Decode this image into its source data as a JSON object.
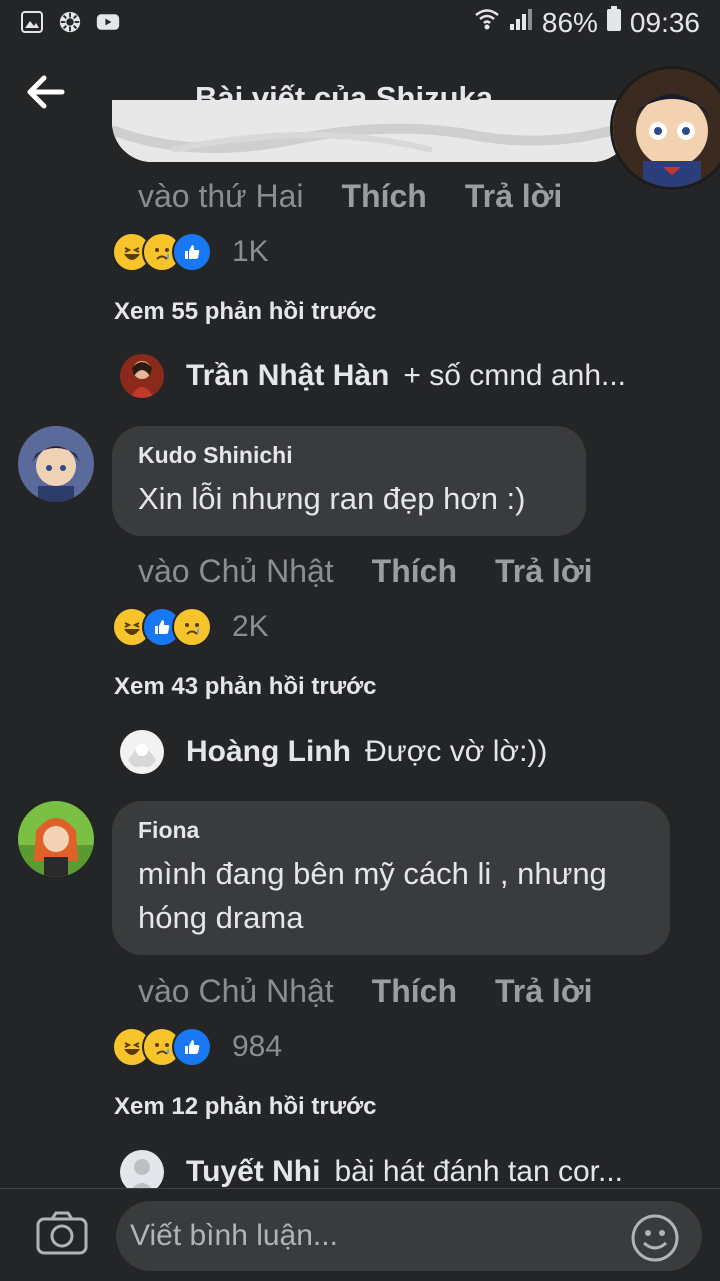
{
  "status_bar": {
    "battery": "86%",
    "time": "09:36",
    "left_icons": [
      "gallery-icon",
      "flower-icon",
      "youtube-icon"
    ],
    "right_icons": [
      "wifi-icon",
      "signal-icon",
      "battery-icon"
    ]
  },
  "header": {
    "back_icon": "arrow-left-icon",
    "title": "Bài viết của Shizuka"
  },
  "comments": [
    {
      "time": "vào thứ Hai",
      "like_label": "Thích",
      "reply_label": "Trả lời",
      "reactions": [
        "haha",
        "sad",
        "like"
      ],
      "reaction_count": "1K",
      "more_replies": "Xem 55 phản hồi trước",
      "preview": {
        "name": "Trần Nhật Hàn",
        "text": "+ số cmnd anh..."
      }
    },
    {
      "author": "Kudo Shinichi",
      "text": "Xin lỗi nhưng ran đẹp hơn :)",
      "time": "vào Chủ Nhật",
      "like_label": "Thích",
      "reply_label": "Trả lời",
      "reactions": [
        "haha",
        "like",
        "sad"
      ],
      "reaction_count": "2K",
      "more_replies": "Xem 43 phản hồi trước",
      "preview": {
        "name": "Hoàng Linh",
        "text": "Được vờ lờ:))"
      }
    },
    {
      "author": "Fiona",
      "text": "mình đang bên mỹ cách li , nhưng hóng drama",
      "time": "vào Chủ Nhật",
      "like_label": "Thích",
      "reply_label": "Trả lời",
      "reactions": [
        "haha",
        "sad",
        "like"
      ],
      "reaction_count": "984",
      "more_replies": "Xem 12 phản hồi trước",
      "preview": {
        "name": "Tuyết Nhi",
        "text": "bài hát đánh tan cor..."
      }
    }
  ],
  "composer": {
    "placeholder": "Viết bình luận...",
    "camera_icon": "camera-icon",
    "emoji_icon": "smiley-icon"
  },
  "colors": {
    "background": "#242526",
    "bubble": "#3a3b3c",
    "like_blue": "#1877f2",
    "haha_yellow": "#f7c52b"
  }
}
